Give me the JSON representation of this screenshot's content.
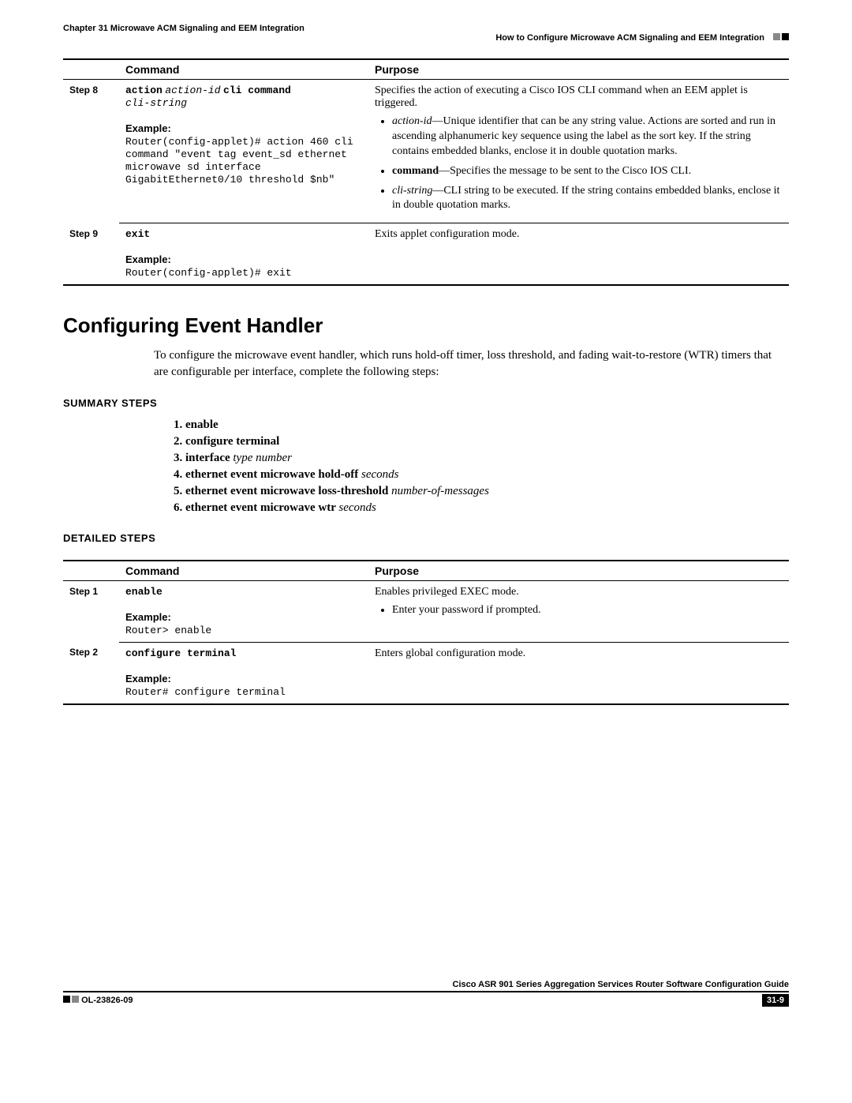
{
  "header": {
    "chapter": "Chapter 31    Microwave ACM Signaling and EEM Integration",
    "section": "How to Configure Microwave ACM Signaling and EEM Integration"
  },
  "table1": {
    "headers": {
      "col1": "Command",
      "col2": "Purpose"
    },
    "rows": [
      {
        "step": "Step 8",
        "cmd_bold1": "action",
        "cmd_ital1": "action-id",
        "cmd_bold2": "cli command",
        "cmd_ital2": "cli-string",
        "example_label": "Example:",
        "example_text": "Router(config-applet)# action 460 cli command \"event tag event_sd ethernet microwave sd interface GigabitEthernet0/10 threshold $nb\"",
        "purpose_intro": "Specifies the action of executing a Cisco IOS CLI command when an EEM applet is triggered.",
        "b1_term": "action-id",
        "b1_text": "—Unique identifier that can be any string value. Actions are sorted and run in ascending alphanumeric key sequence using the label as the sort key. If the string contains embedded blanks, enclose it in double quotation marks.",
        "b2_term": "command",
        "b2_text": "—Specifies the message to be sent to the Cisco IOS CLI.",
        "b3_term": "cli-string",
        "b3_text": "—CLI string to be executed. If the string contains embedded blanks, enclose it in double quotation marks."
      },
      {
        "step": "Step 9",
        "cmd_bold1": "exit",
        "example_label": "Example:",
        "example_text": "Router(config-applet)# exit",
        "purpose_intro": "Exits applet configuration mode."
      }
    ]
  },
  "section2": {
    "title": "Configuring Event Handler",
    "intro": "To configure the microwave event handler, which runs hold-off timer, loss threshold, and fading wait-to-restore (WTR) timers that are configurable per interface, complete the following steps:",
    "summary_label": "SUMMARY STEPS",
    "summary": [
      {
        "bold": "enable",
        "ital": ""
      },
      {
        "bold": "configure terminal",
        "ital": ""
      },
      {
        "bold": "interface",
        "ital": "type number"
      },
      {
        "bold": "ethernet event microwave hold-off",
        "ital": "seconds"
      },
      {
        "bold": "ethernet event microwave loss-threshold",
        "ital": "number-of-messages"
      },
      {
        "bold": "ethernet event microwave wtr",
        "ital": "seconds"
      }
    ],
    "detailed_label": "DETAILED STEPS"
  },
  "table2": {
    "headers": {
      "col1": "Command",
      "col2": "Purpose"
    },
    "rows": [
      {
        "step": "Step 1",
        "cmd_bold1": "enable",
        "example_label": "Example:",
        "example_text": "Router> enable",
        "purpose_intro": "Enables privileged EXEC mode.",
        "b1_text": "Enter your password if prompted."
      },
      {
        "step": "Step 2",
        "cmd_bold1": "configure terminal",
        "example_label": "Example:",
        "example_text": "Router# configure terminal",
        "purpose_intro": "Enters global configuration mode."
      }
    ]
  },
  "footer": {
    "guide": "Cisco ASR 901 Series Aggregation Services Router Software Configuration Guide",
    "doc": "OL-23826-09",
    "page": "31-9"
  }
}
